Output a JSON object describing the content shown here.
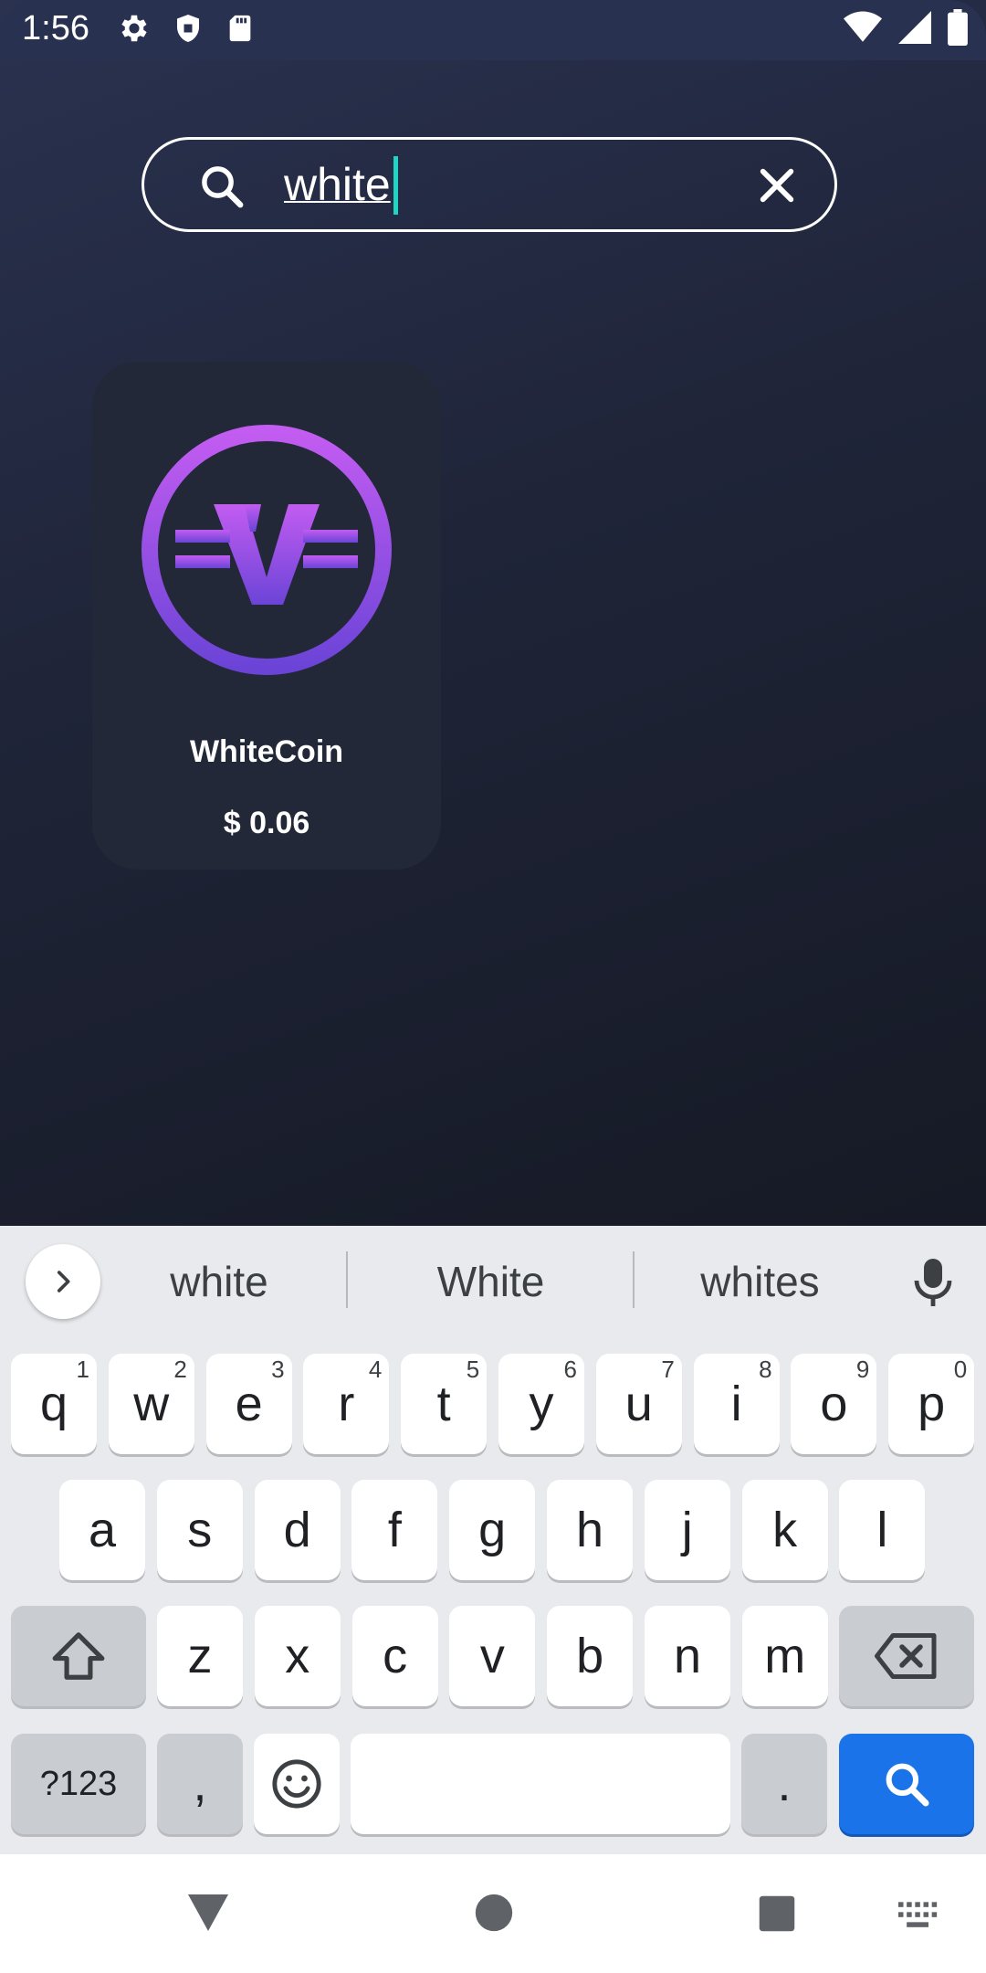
{
  "status_bar": {
    "time": "1:56",
    "left_icons": [
      "settings-icon",
      "shield-icon",
      "sd-card-icon"
    ],
    "right_icons": [
      "wifi-icon",
      "signal-icon",
      "battery-icon"
    ]
  },
  "search": {
    "query": "white",
    "icons": [
      "search-icon",
      "clear-icon"
    ]
  },
  "results": [
    {
      "name": "WhiteCoin",
      "price": "$ 0.06",
      "logo_colors": [
        "#c35cf1",
        "#6b44d7"
      ]
    }
  ],
  "keyboard": {
    "suggestions": [
      "white",
      "White",
      "whites"
    ],
    "row1": [
      {
        "k": "q",
        "n": "1"
      },
      {
        "k": "w",
        "n": "2"
      },
      {
        "k": "e",
        "n": "3"
      },
      {
        "k": "r",
        "n": "4"
      },
      {
        "k": "t",
        "n": "5"
      },
      {
        "k": "y",
        "n": "6"
      },
      {
        "k": "u",
        "n": "7"
      },
      {
        "k": "i",
        "n": "8"
      },
      {
        "k": "o",
        "n": "9"
      },
      {
        "k": "p",
        "n": "0"
      }
    ],
    "row2": [
      "a",
      "s",
      "d",
      "f",
      "g",
      "h",
      "j",
      "k",
      "l"
    ],
    "row3": [
      "z",
      "x",
      "c",
      "v",
      "b",
      "n",
      "m"
    ],
    "symbols_label": "?123",
    "comma": ",",
    "period": ".",
    "action_color": "#1a73e8"
  },
  "nav_bar": {
    "icons": [
      "back-icon",
      "home-icon",
      "recents-icon",
      "keyboard-switch-icon"
    ]
  }
}
